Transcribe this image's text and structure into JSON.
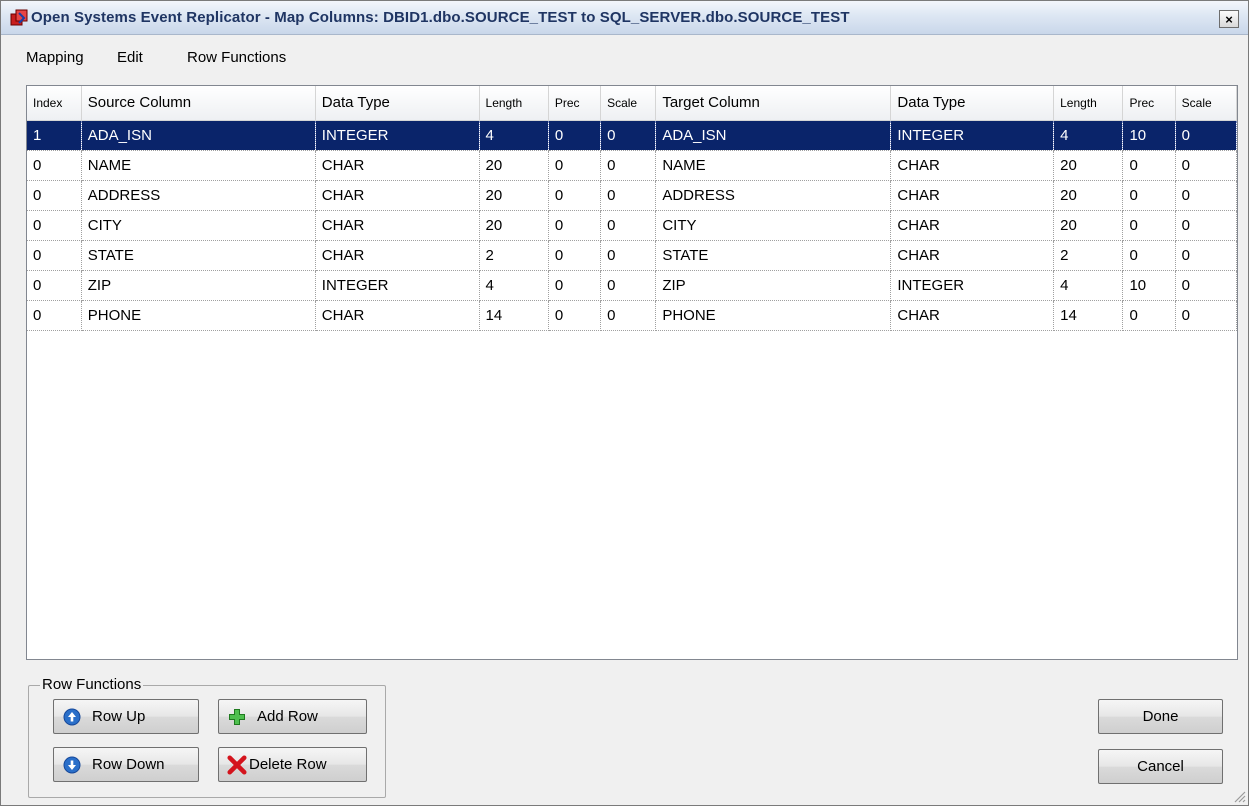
{
  "window": {
    "title": "Open Systems Event Replicator - Map Columns:  DBID1.dbo.SOURCE_TEST  to  SQL_SERVER.dbo.SOURCE_TEST",
    "close_glyph": "×"
  },
  "menu": [
    {
      "label": "Mapping"
    },
    {
      "label": "Edit"
    },
    {
      "label": "Row Functions"
    }
  ],
  "grid": {
    "columns": [
      "Index",
      "Source Column",
      "Data Type",
      "Length",
      "Prec",
      "Scale",
      "Target Column",
      "Data Type",
      "Length",
      "Prec",
      "Scale"
    ],
    "rows": [
      [
        "1",
        "ADA_ISN",
        "INTEGER",
        "4",
        "0",
        "0",
        "ADA_ISN",
        "INTEGER",
        "4",
        "10",
        "0"
      ],
      [
        "0",
        "NAME",
        "CHAR",
        "20",
        "0",
        "0",
        "NAME",
        "CHAR",
        "20",
        "0",
        "0"
      ],
      [
        "0",
        "ADDRESS",
        "CHAR",
        "20",
        "0",
        "0",
        "ADDRESS",
        "CHAR",
        "20",
        "0",
        "0"
      ],
      [
        "0",
        "CITY",
        "CHAR",
        "20",
        "0",
        "0",
        "CITY",
        "CHAR",
        "20",
        "0",
        "0"
      ],
      [
        "0",
        "STATE",
        "CHAR",
        "2",
        "0",
        "0",
        "STATE",
        "CHAR",
        "2",
        "0",
        "0"
      ],
      [
        "0",
        "ZIP",
        "INTEGER",
        "4",
        "0",
        "0",
        "ZIP",
        "INTEGER",
        "4",
        "10",
        "0"
      ],
      [
        "0",
        "PHONE",
        "CHAR",
        "14",
        "0",
        "0",
        "PHONE",
        "CHAR",
        "14",
        "0",
        "0"
      ]
    ],
    "selected_row": 0
  },
  "row_functions": {
    "group_label": "Row Functions",
    "row_up": {
      "label": "Row Up",
      "icon": "arrow-up-circle-icon"
    },
    "add_row": {
      "label": "Add Row",
      "icon": "plus-icon"
    },
    "row_down": {
      "label": "Row Down",
      "icon": "arrow-down-circle-icon"
    },
    "delete_row": {
      "label": "Delete Row",
      "icon": "red-x-icon"
    }
  },
  "actions": {
    "done": "Done",
    "cancel": "Cancel"
  },
  "colors": {
    "selection": "#0a246a",
    "title_text": "#1f3563",
    "plus_green": "#2e9b2e",
    "delete_red": "#d4141d",
    "arrow_blue": "#2a6fc9"
  }
}
